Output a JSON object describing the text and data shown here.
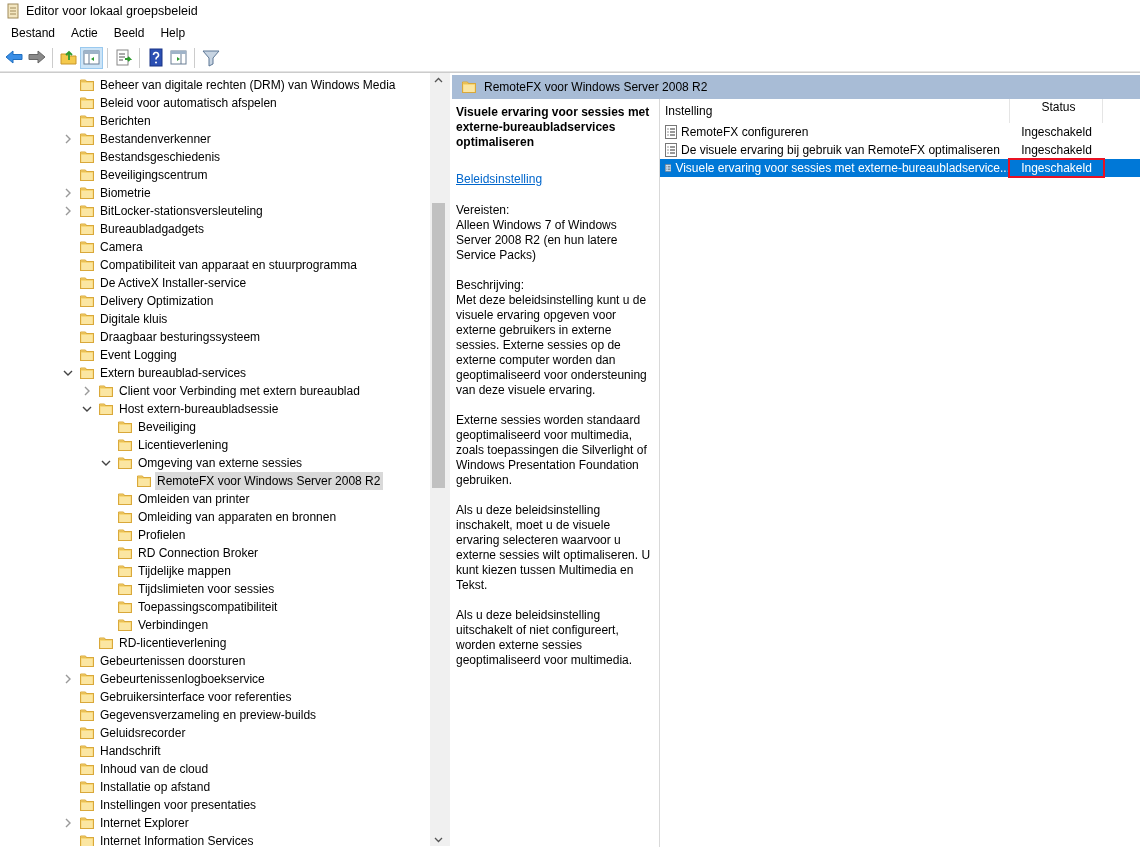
{
  "window": {
    "title": "Editor voor lokaal groepsbeleid"
  },
  "menu": [
    "Bestand",
    "Actie",
    "Beeld",
    "Help"
  ],
  "toolbar_groups": [
    [
      {
        "kind": "back",
        "pressed": false
      },
      {
        "kind": "forward",
        "pressed": false
      }
    ],
    [
      {
        "kind": "up",
        "pressed": false
      },
      {
        "kind": "tree",
        "pressed": true
      }
    ],
    [
      {
        "kind": "export",
        "pressed": false
      }
    ],
    [
      {
        "kind": "help",
        "pressed": false
      },
      {
        "kind": "pane",
        "pressed": false
      }
    ],
    [
      {
        "kind": "filter",
        "pressed": false
      }
    ]
  ],
  "tree": [
    {
      "label": "Beheer van digitale rechten (DRM) van Windows Media",
      "selected": false
    },
    {
      "label": "Beleid voor automatisch afspelen",
      "selected": false
    },
    {
      "label": "Berichten",
      "selected": false
    },
    {
      "label": "Bestandenverkenner",
      "expanded": false,
      "selected": false
    },
    {
      "label": "Bestandsgeschiedenis",
      "selected": false
    },
    {
      "label": "Beveiligingscentrum",
      "selected": false
    },
    {
      "label": "Biometrie",
      "expanded": false,
      "selected": false
    },
    {
      "label": "BitLocker-stationsversleuteling",
      "expanded": false,
      "selected": false
    },
    {
      "label": "Bureaubladgadgets",
      "selected": false
    },
    {
      "label": "Camera",
      "selected": false
    },
    {
      "label": "Compatibiliteit van apparaat en stuurprogramma",
      "selected": false
    },
    {
      "label": "De ActiveX Installer-service",
      "selected": false
    },
    {
      "label": "Delivery Optimization",
      "selected": false
    },
    {
      "label": "Digitale kluis",
      "selected": false
    },
    {
      "label": "Draagbaar  besturingssysteem",
      "selected": false
    },
    {
      "label": "Event Logging",
      "selected": false
    },
    {
      "label": "Extern bureaublad-services",
      "expanded": true,
      "selected": false,
      "children": [
        {
          "label": "Client voor Verbinding met extern bureaublad",
          "expanded": false,
          "selected": false
        },
        {
          "label": "Host extern-bureaubladsessie",
          "expanded": true,
          "selected": false,
          "children": [
            {
              "label": "Beveiliging",
              "selected": false
            },
            {
              "label": "Licentieverlening",
              "selected": false
            },
            {
              "label": "Omgeving van externe sessies",
              "expanded": true,
              "selected": false,
              "children": [
                {
                  "label": "RemoteFX voor Windows Server 2008 R2",
                  "selected": true
                }
              ]
            },
            {
              "label": "Omleiden van printer",
              "selected": false
            },
            {
              "label": "Omleiding van apparaten en bronnen",
              "selected": false
            },
            {
              "label": "Profielen",
              "selected": false
            },
            {
              "label": "RD Connection Broker",
              "selected": false
            },
            {
              "label": "Tijdelijke mappen",
              "selected": false
            },
            {
              "label": "Tijdslimieten voor sessies",
              "selected": false
            },
            {
              "label": "Toepassingscompatibiliteit",
              "selected": false
            },
            {
              "label": "Verbindingen",
              "selected": false
            }
          ]
        },
        {
          "label": "RD-licentieverlening",
          "selected": false
        }
      ]
    },
    {
      "label": "Gebeurtenissen doorsturen",
      "selected": false
    },
    {
      "label": "Gebeurtenissenlogboekservice",
      "expanded": false,
      "selected": false
    },
    {
      "label": "Gebruikersinterface voor referenties",
      "selected": false
    },
    {
      "label": "Gegevensverzameling en preview-builds",
      "selected": false
    },
    {
      "label": "Geluidsrecorder",
      "selected": false
    },
    {
      "label": "Handschrift",
      "selected": false
    },
    {
      "label": "Inhoud van de cloud",
      "selected": false
    },
    {
      "label": "Installatie op afstand",
      "selected": false
    },
    {
      "label": "Instellingen voor presentaties",
      "selected": false
    },
    {
      "label": "Internet Explorer",
      "expanded": false,
      "selected": false
    },
    {
      "label": "Internet Information Services",
      "selected": false
    }
  ],
  "details": {
    "header": "RemoteFX voor Windows Server 2008 R2",
    "title": "Visuele ervaring voor sessies met externe-bureaubladservices optimaliseren",
    "link": "Beleidsinstelling",
    "paragraphs": [
      "Vereisten:\nAlleen Windows 7 of Windows Server 2008 R2 (en hun latere Service Packs)",
      "Beschrijving:\nMet deze beleidsinstelling kunt u de visuele ervaring opgeven voor externe gebruikers in externe sessies. Externe sessies op de externe computer worden dan geoptimaliseerd voor ondersteuning van deze visuele ervaring.",
      "Externe sessies worden standaard geoptimaliseerd voor multimedia, zoals toepassingen die Silverlight of Windows Presentation Foundation gebruiken.",
      "Als u deze beleidsinstelling inschakelt, moet u de visuele ervaring selecteren waarvoor u externe sessies wilt optimaliseren. U kunt kiezen tussen Multimedia en Tekst.",
      "Als u deze beleidsinstelling uitschakelt of niet configureert, worden externe sessies geoptimaliseerd voor multimedia."
    ]
  },
  "table": {
    "columns": [
      "Instelling",
      "Status"
    ],
    "rows": [
      {
        "setting": "RemoteFX configureren",
        "status": "Ingeschakeld",
        "selected": false,
        "highlighted": false
      },
      {
        "setting": "De visuele ervaring bij gebruik van RemoteFX optimaliseren",
        "status": "Ingeschakeld",
        "selected": false,
        "highlighted": false
      },
      {
        "setting": "Visuele ervaring voor sessies met externe-bureaubladservice...",
        "status": "Ingeschakeld",
        "selected": true,
        "highlighted": true
      }
    ]
  }
}
